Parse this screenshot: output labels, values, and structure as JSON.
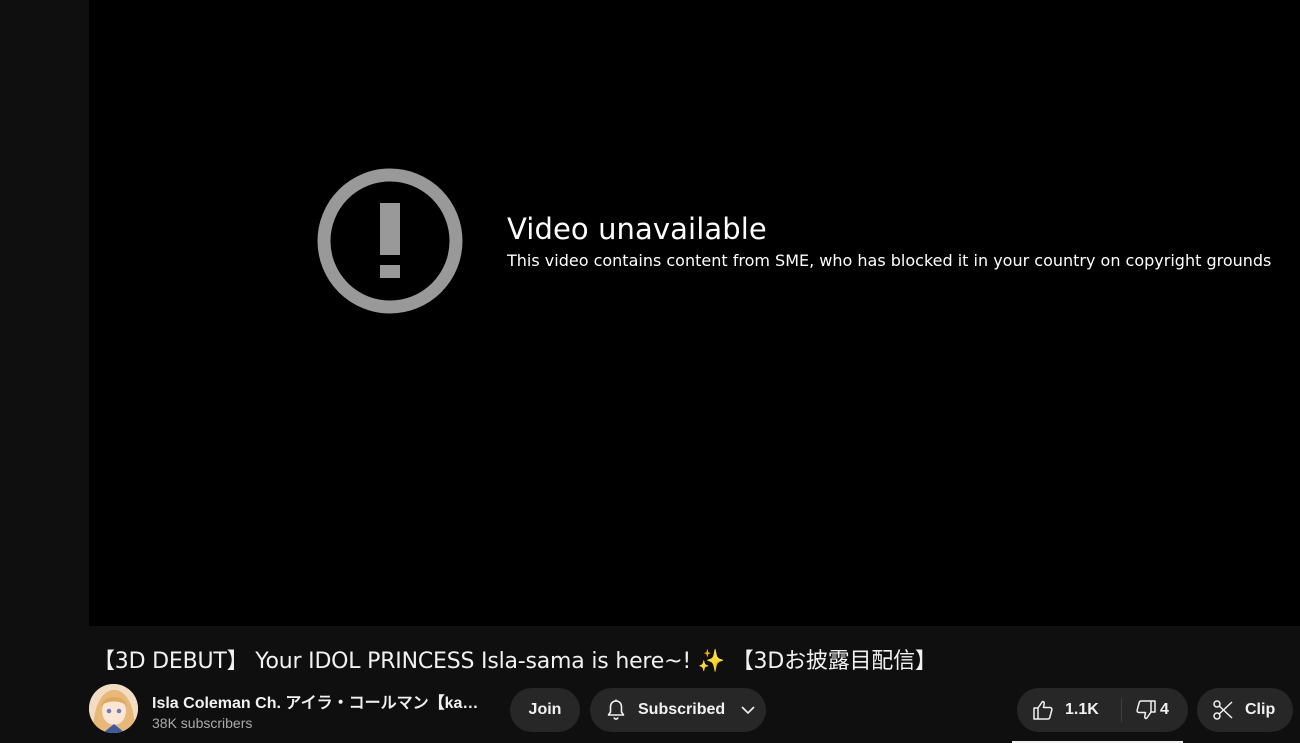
{
  "error": {
    "title": "Video unavailable",
    "reason": "This video contains content from SME, who has blocked it in your country on copyright grounds"
  },
  "video": {
    "title_part1": "【3D DEBUT】 Your IDOL PRINCESS Isla-sama is here~! ",
    "title_sparkle": "✨",
    "title_part2": " 【3Dお披露目配信】"
  },
  "channel": {
    "name": "Isla Coleman Ch. アイラ・コールマン【kaw…",
    "subscribers": "38K subscribers"
  },
  "actions": {
    "join_label": "Join",
    "subscribed_label": "Subscribed",
    "like_count": "1.1K",
    "dislike_count": "4",
    "clip_label": "Clip"
  },
  "icons": [
    "error-icon",
    "bell-icon",
    "chevron-down-icon",
    "thumbs-up-icon",
    "thumbs-down-icon",
    "scissors-icon"
  ]
}
